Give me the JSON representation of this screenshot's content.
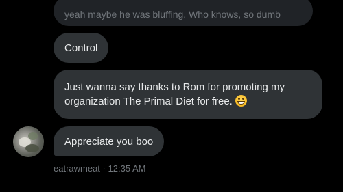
{
  "conversation": {
    "quoted_reply": "yeah maybe he was bluffing. Who knows, so dumb",
    "messages": [
      {
        "text": "Control"
      },
      {
        "text": "Just wanna say thanks to Rom for promoting my organization The Primal Diet for free.",
        "emoji": "grinning-face-emoji"
      },
      {
        "text": "Appreciate you boo"
      }
    ],
    "sender": {
      "username": "eatrawmeat",
      "separator": "·",
      "timestamp": "12:35 AM"
    }
  },
  "colors": {
    "background": "#000000",
    "bubble": "#2f3336",
    "quoted_bubble": "#202327",
    "text": "#e7e9ea",
    "muted": "#71767b"
  }
}
